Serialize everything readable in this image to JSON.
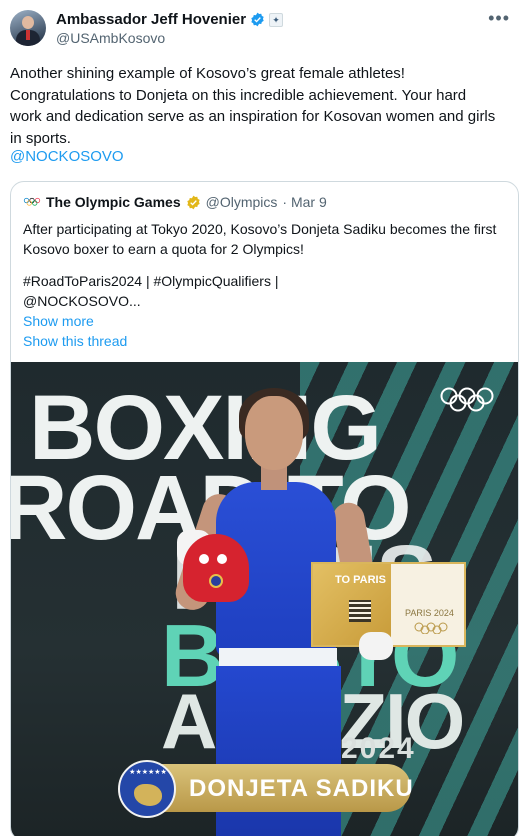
{
  "author": {
    "name": "Ambassador Jeff Hovenier",
    "handle": "@USAmbKosovo"
  },
  "tweet": {
    "lines": [
      "Another shining example of Kosovo’s great female athletes!",
      "Congratulations to Donjeta on this incredible achievement. Your hard",
      "work and dedication serve as an inspiration for Kosovan women and girls",
      "in sports."
    ],
    "mention": "@NOCKOSOVO"
  },
  "quoted": {
    "name": "The Olympic Games",
    "handle": "@Olympics",
    "date": "· Mar 9",
    "body_lines": [
      "After participating at Tokyo 2020, Kosovo’s Donjeta Sadiku becomes the first",
      "Kosovo boxer to earn a quota for 2 Olympics!"
    ],
    "hashtag_lines": [
      "#RoadToParis2024 | #OlympicQualifiers |",
      "@NOCKOSOVO..."
    ],
    "show_more": "Show more",
    "show_thread": "Show this thread"
  },
  "photo": {
    "backdrop_words": [
      "BOXING",
      "ROAD TO",
      "PARIS",
      "BUSTO",
      "ARSIZIO"
    ],
    "year": "2024",
    "certificate_title": "TO PARIS",
    "certificate_sub": "PARIS 2024",
    "banner_name": "DONJETA SADIKU"
  },
  "colors": {
    "link": "#1d9bf0",
    "verified_blue": "#1d9bf0",
    "verified_gold": "#e2b719",
    "banner_gold": "#c9a95c"
  },
  "icons": {
    "verified": "verified-badge-icon",
    "more": "more-options-icon",
    "olympic": "olympic-rings-icon"
  }
}
